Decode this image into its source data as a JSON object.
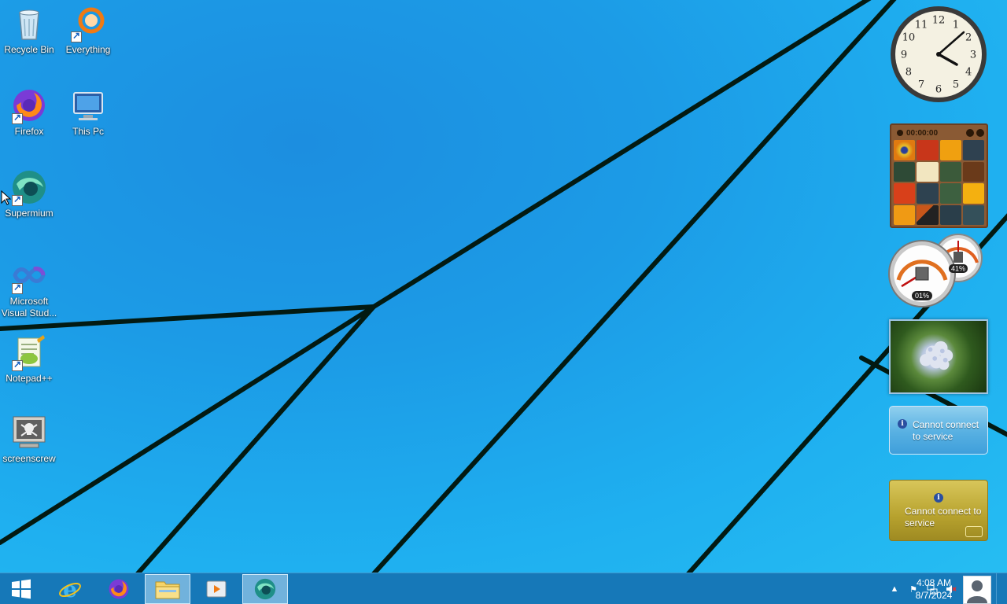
{
  "desktop": {
    "icons": [
      {
        "label": "Recycle Bin",
        "icon": "recycle-bin-icon"
      },
      {
        "label": "Everything",
        "icon": "everything-search-icon"
      },
      {
        "label": "Firefox",
        "icon": "firefox-icon"
      },
      {
        "label": "This Pc",
        "icon": "computer-icon"
      },
      {
        "label": "Supermium",
        "icon": "supermium-icon"
      },
      {
        "label": "Microsoft Visual Stud...",
        "icon": "visual-studio-icon"
      },
      {
        "label": "Notepad++",
        "icon": "notepadpp-icon"
      },
      {
        "label": "screenscrew",
        "icon": "skull-monitor-icon"
      }
    ]
  },
  "gadgets": {
    "clock": {
      "numerals": [
        "12",
        "1",
        "2",
        "3",
        "4",
        "5",
        "6",
        "7",
        "8",
        "9",
        "10",
        "11"
      ],
      "time": "4:08"
    },
    "puzzle": {
      "timer": "00:00:00"
    },
    "cpu_meter": {
      "cpu": "01%",
      "memory": "41%",
      "cpu_fraction": 0.01,
      "memory_fraction": 0.41
    },
    "weather": {
      "message": "Cannot connect to service"
    },
    "currency": {
      "message": "Cannot connect to service"
    }
  },
  "taskbar": {
    "buttons": [
      {
        "name": "start",
        "icon": "windows-logo-icon"
      },
      {
        "name": "internet-explorer",
        "icon": "internet-explorer-icon"
      },
      {
        "name": "firefox",
        "icon": "firefox-icon"
      },
      {
        "name": "file-explorer",
        "icon": "folder-icon"
      },
      {
        "name": "media-player",
        "icon": "media-player-icon"
      },
      {
        "name": "supermium",
        "icon": "supermium-icon"
      }
    ],
    "tray": [
      "chevron-up-icon",
      "flag-icon",
      "network-icon",
      "volume-muted-icon"
    ],
    "time": "4:08 AM",
    "date": "8/7/2024"
  },
  "colors": {
    "taskbar": "#1678b8",
    "desktop": "#1c9be6"
  }
}
